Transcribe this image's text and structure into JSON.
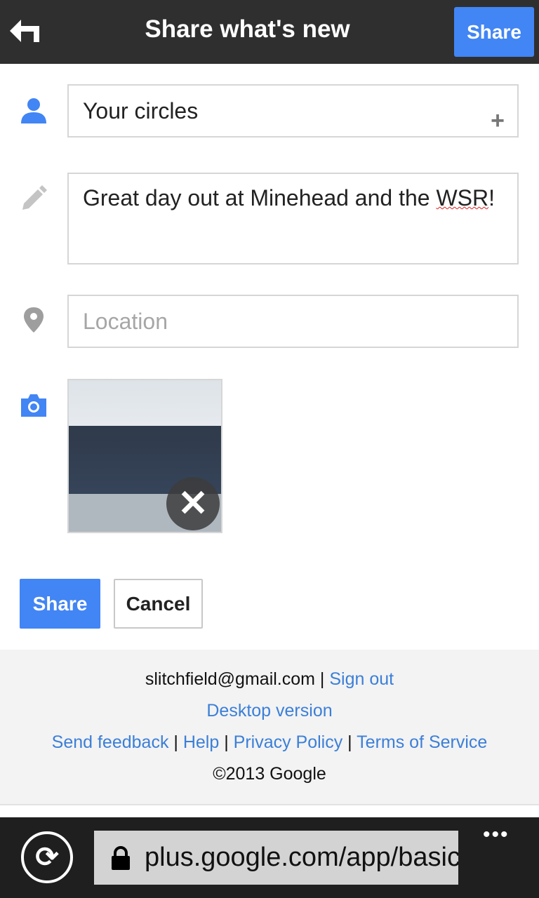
{
  "header": {
    "title": "Share what's new",
    "share_label": "Share"
  },
  "form": {
    "circles": "Your circles",
    "circles_add": "+",
    "message_main": "Great day out at Minehead and the ",
    "message_misspelled": "WSR",
    "message_end": "!",
    "location_placeholder": "Location",
    "remove_photo": "✕"
  },
  "actions": {
    "share": "Share",
    "cancel": "Cancel"
  },
  "footer": {
    "email": "slitchfield@gmail.com",
    "sep": " | ",
    "sign_out": "Sign out",
    "desktop": "Desktop version",
    "send_feedback": "Send feedback",
    "help": "Help",
    "privacy": "Privacy Policy",
    "terms": "Terms of Service",
    "copyright": "©2013 Google"
  },
  "browser": {
    "url": "plus.google.com/app/basic",
    "more": "•••"
  },
  "colors": {
    "accent": "#4285f4",
    "link": "#3b7fd8",
    "header_bg": "#2f2f2f"
  }
}
